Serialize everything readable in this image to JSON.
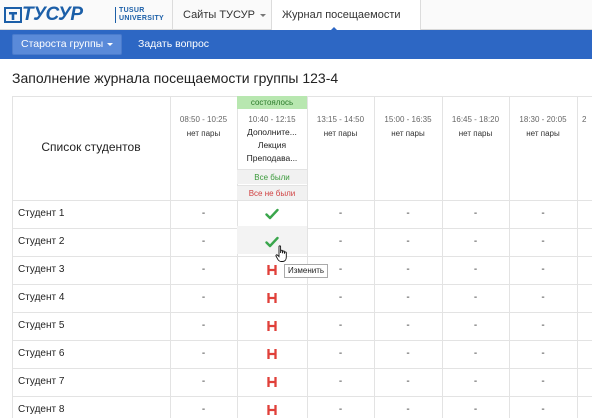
{
  "topnav": {
    "logo_text": "ТУСУР",
    "logo_sub_1": "TUSUR",
    "logo_sub_2": "UNIVERSITY",
    "sites_label": "Сайты ТУСУР",
    "journal_label": "Журнал посещаемости"
  },
  "bluebar": {
    "starosta_label": "Староста группы",
    "ask_label": "Задать вопрос"
  },
  "page_title": "Заполнение журнала посещаемости группы 123-4",
  "table": {
    "students_header": "Список студентов",
    "slots": [
      {
        "time": "08:50 - 10:25",
        "status": "нет пары"
      },
      {
        "time": "10:40 - 12:15",
        "status": "состоялось",
        "lesson": [
          "Дополните...",
          "Лекция",
          "Преподава..."
        ],
        "all_present": "Все были",
        "all_absent": "Все не были"
      },
      {
        "time": "13:15 - 14:50",
        "status": "нет пары"
      },
      {
        "time": "15:00 - 16:35",
        "status": "нет пары"
      },
      {
        "time": "16:45 - 18:20",
        "status": "нет пары"
      },
      {
        "time": "18:30 - 20:05",
        "status": "нет пары"
      },
      {
        "time": "2",
        "status": ""
      }
    ],
    "students": [
      {
        "name": "Студент 1",
        "mark": "present"
      },
      {
        "name": "Студент 2",
        "mark": "present"
      },
      {
        "name": "Студент 3",
        "mark": "absent"
      },
      {
        "name": "Студент 4",
        "mark": "absent"
      },
      {
        "name": "Студент 5",
        "mark": "absent"
      },
      {
        "name": "Студент 6",
        "mark": "absent"
      },
      {
        "name": "Студент 7",
        "mark": "absent"
      },
      {
        "name": "Студент 8",
        "mark": "absent"
      }
    ],
    "empty_mark": "-",
    "tooltip": "Изменить"
  },
  "colors": {
    "brand_blue": "#2d67c4",
    "present_green": "#3aa64c",
    "absent_red": "#e0403a",
    "held_badge": "#b8e7b0"
  }
}
